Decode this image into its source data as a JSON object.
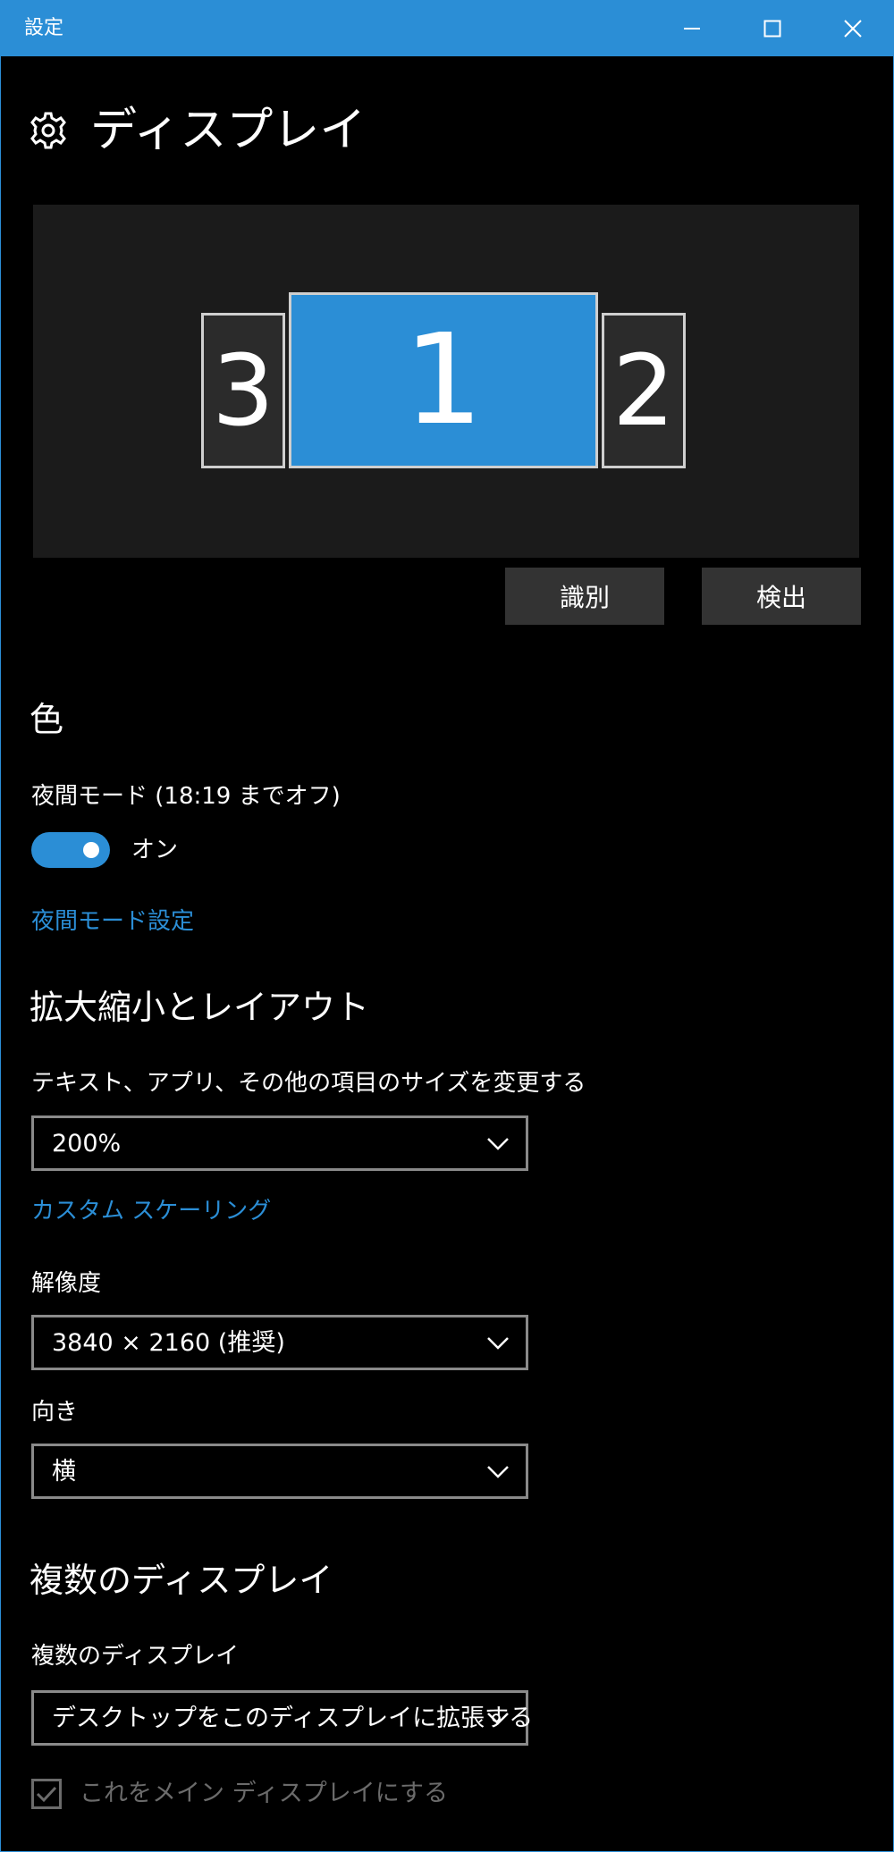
{
  "window": {
    "title": "設定",
    "controls": {
      "minimize_icon": "minimize-icon",
      "maximize_icon": "maximize-icon",
      "close_icon": "close-icon"
    }
  },
  "header": {
    "icon": "gear-icon",
    "title": "ディスプレイ"
  },
  "arrangement": {
    "monitors": [
      {
        "label": "3",
        "selected": false
      },
      {
        "label": "1",
        "selected": true
      },
      {
        "label": "2",
        "selected": false
      }
    ],
    "colors": {
      "selected": "#2b8ed6",
      "unselected": "#2b2b2b"
    },
    "identify_label": "識別",
    "detect_label": "検出"
  },
  "color": {
    "heading": "色",
    "night_mode_label": "夜間モード (18:19 までオフ)",
    "toggle_state": "オン",
    "toggle_on": true,
    "night_mode_settings_link": "夜間モード設定"
  },
  "scale_layout": {
    "heading": "拡大縮小とレイアウト",
    "size_label": "テキスト、アプリ、その他の項目のサイズを変更する",
    "size_value": "200%",
    "custom_scaling_link": "カスタム スケーリング",
    "resolution_label": "解像度",
    "resolution_value": "3840 × 2160 (推奨)",
    "orientation_label": "向き",
    "orientation_value": "横"
  },
  "multiple_displays": {
    "heading": "複数のディスプレイ",
    "label": "複数のディスプレイ",
    "value": "デスクトップをこのディスプレイに拡張する",
    "main_display_checkbox_label": "これをメイン ディスプレイにする",
    "main_display_checked": true
  },
  "accent_color": "#2b8ed6"
}
